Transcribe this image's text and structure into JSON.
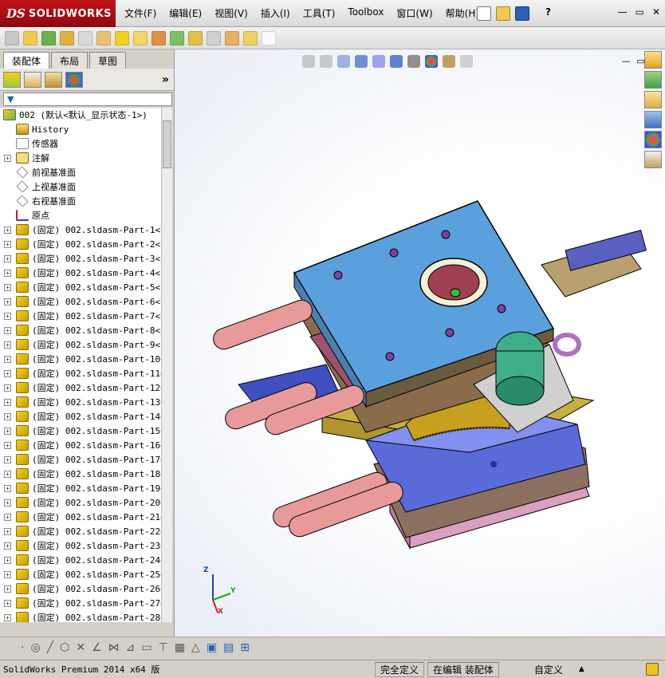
{
  "app": {
    "logo_ds": "DS",
    "logo_text": "SOLIDWORKS"
  },
  "menu": [
    "文件(F)",
    "编辑(E)",
    "视图(V)",
    "插入(I)",
    "工具(T)",
    "Toolbox",
    "窗口(W)",
    "帮助(H)"
  ],
  "window_controls": {
    "minimize": "—",
    "restore": "▭",
    "close": "✕",
    "help": "?"
  },
  "tabs": [
    {
      "label": "装配体",
      "active": true
    },
    {
      "label": "布局",
      "active": false
    },
    {
      "label": "草图",
      "active": false
    }
  ],
  "panel": {
    "expand": "»"
  },
  "tree": {
    "root": "002  (默认<默认_显示状态-1>)",
    "items": [
      {
        "label": "History",
        "expandable": false,
        "icon": "history-icon"
      },
      {
        "label": "传感器",
        "expandable": false,
        "icon": "sensor-icon"
      },
      {
        "label": "注解",
        "expandable": true,
        "icon": "annotation-icon"
      },
      {
        "label": "前视基准面",
        "expandable": false,
        "icon": "plane-icon"
      },
      {
        "label": "上视基准面",
        "expandable": false,
        "icon": "plane-icon"
      },
      {
        "label": "右视基准面",
        "expandable": false,
        "icon": "plane-icon"
      },
      {
        "label": "原点",
        "expandable": false,
        "icon": "origin-icon"
      }
    ],
    "parts": [
      "(固定) 002.sldasm-Part-1<1",
      "(固定) 002.sldasm-Part-2<1",
      "(固定) 002.sldasm-Part-3<1",
      "(固定) 002.sldasm-Part-4<1",
      "(固定) 002.sldasm-Part-5<1",
      "(固定) 002.sldasm-Part-6<1",
      "(固定) 002.sldasm-Part-7<1",
      "(固定) 002.sldasm-Part-8<1",
      "(固定) 002.sldasm-Part-9<1",
      "(固定) 002.sldasm-Part-10<",
      "(固定) 002.sldasm-Part-11<",
      "(固定) 002.sldasm-Part-12<",
      "(固定) 002.sldasm-Part-13<",
      "(固定) 002.sldasm-Part-14<",
      "(固定) 002.sldasm-Part-15<",
      "(固定) 002.sldasm-Part-16<",
      "(固定) 002.sldasm-Part-17<",
      "(固定) 002.sldasm-Part-18<",
      "(固定) 002.sldasm-Part-19<",
      "(固定) 002.sldasm-Part-20<",
      "(固定) 002.sldasm-Part-21<",
      "(固定) 002.sldasm-Part-22<",
      "(固定) 002.sldasm-Part-23<",
      "(固定) 002.sldasm-Part-24<",
      "(固定) 002.sldasm-Part-25<",
      "(固定) 002.sldasm-Part-26<",
      "(固定) 002.sldasm-Part-27<",
      "(固定) 002.sldasm-Part-28<"
    ]
  },
  "triad": {
    "x": "X",
    "y": "Y",
    "z": "Z"
  },
  "status": {
    "product": "SolidWorks Premium 2014 x64 版",
    "defined": "完全定义",
    "editing": "在编辑 装配体",
    "units": "自定义",
    "units_arrow": "▲"
  },
  "colors": {
    "plate_top": "#5aa0dc",
    "plate_brown": "#8b6c4a",
    "cylinder_pink": "#e89a9a",
    "motor_green": "#3fae8a",
    "gear_gold": "#c8a020",
    "lower_blue": "#5a6ad8"
  }
}
